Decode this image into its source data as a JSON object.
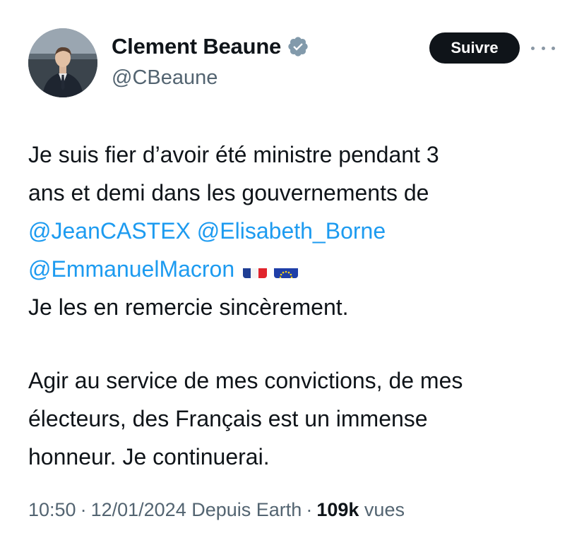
{
  "author": {
    "display_name": "Clement Beaune",
    "handle": "@CBeaune"
  },
  "follow_label": "Suivre",
  "tweet": {
    "line1": "Je suis fier d’avoir été ministre pendant 3",
    "line2": "ans et demi dans les gouvernements de",
    "mention1": "@JeanCASTEX",
    "mention2": "@Elisabeth_Borne",
    "mention3": "@EmmanuelMacron",
    "line5": "Je les en remercie sincèrement.",
    "line6": "Agir au service de mes convictions, de mes",
    "line7": "électeurs, des Français est un immense",
    "line8": "honneur. Je continuerai."
  },
  "flags": [
    "french-flag",
    "eu-flag"
  ],
  "meta": {
    "time": "10:50",
    "date": "12/01/2024",
    "source": "Depuis Earth",
    "separator": "·",
    "views_count": "109k",
    "views_label": "vues"
  },
  "colors": {
    "text": "#0f1419",
    "secondary": "#536471",
    "link": "#1d9bf0",
    "button": "#0f1419"
  }
}
